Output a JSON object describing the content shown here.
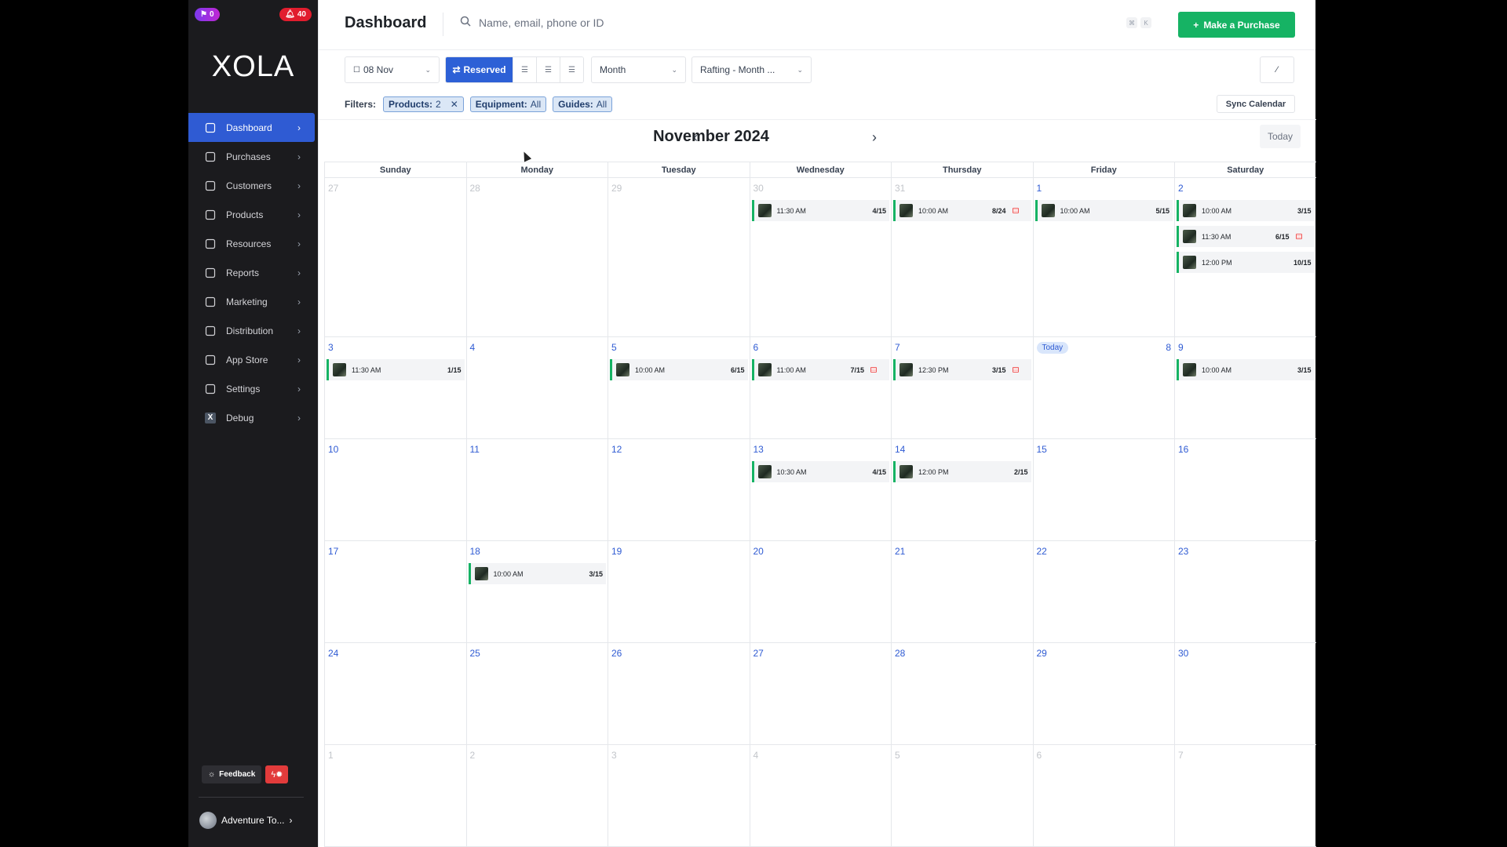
{
  "badges": {
    "notifications_left": "0",
    "alerts_right": "40"
  },
  "brand": "XOLA",
  "sidebar": {
    "items": [
      {
        "label": "Dashboard",
        "icon": "dashboard-icon",
        "active": true
      },
      {
        "label": "Purchases",
        "icon": "tag-icon"
      },
      {
        "label": "Customers",
        "icon": "users-icon"
      },
      {
        "label": "Products",
        "icon": "box-icon"
      },
      {
        "label": "Resources",
        "icon": "clipboard-icon"
      },
      {
        "label": "Reports",
        "icon": "bar-chart-icon"
      },
      {
        "label": "Marketing",
        "icon": "megaphone-icon"
      },
      {
        "label": "Distribution",
        "icon": "network-icon"
      },
      {
        "label": "App Store",
        "icon": "store-icon"
      },
      {
        "label": "Settings",
        "icon": "sliders-icon"
      },
      {
        "label": "Debug",
        "icon": "debug-x-icon"
      }
    ],
    "feedback_label": "Feedback",
    "account_label": "Adventure To..."
  },
  "header": {
    "title": "Dashboard",
    "search_placeholder": "Name, email, phone or ID",
    "kbd1": "⌘",
    "kbd2": "K",
    "purchase_label": "Make a Purchase"
  },
  "toolbar": {
    "date": "08 Nov",
    "reserved_label": "Reserved",
    "view": "Month",
    "product": "Rafting - Month ..."
  },
  "filters": {
    "label": "Filters:",
    "products_key": "Products:",
    "products_val": "2",
    "equipment_key": "Equipment:",
    "equipment_val": "All",
    "guides_key": "Guides:",
    "guides_val": "All",
    "sync_label": "Sync Calendar"
  },
  "calendar": {
    "title": "November 2024",
    "today_label": "Today",
    "days": [
      "Sunday",
      "Monday",
      "Tuesday",
      "Wednesday",
      "Thursday",
      "Friday",
      "Saturday"
    ],
    "weeks": [
      [
        {
          "d": "27",
          "muted": true,
          "ev": []
        },
        {
          "d": "28",
          "muted": true,
          "ev": []
        },
        {
          "d": "29",
          "muted": true,
          "ev": []
        },
        {
          "d": "30",
          "muted": true,
          "ev": [
            {
              "t": "11:30 AM",
              "c": "4/15"
            }
          ]
        },
        {
          "d": "31",
          "muted": true,
          "ev": [
            {
              "t": "10:00 AM",
              "c": "8/24",
              "flag": true
            }
          ]
        },
        {
          "d": "1",
          "ev": [
            {
              "t": "10:00 AM",
              "c": "5/15"
            }
          ]
        },
        {
          "d": "2",
          "ev": [
            {
              "t": "10:00 AM",
              "c": "3/15"
            },
            {
              "t": "11:30 AM",
              "c": "6/15",
              "flag": true
            },
            {
              "t": "12:00 PM",
              "c": "10/15"
            }
          ]
        }
      ],
      [
        {
          "d": "3",
          "ev": [
            {
              "t": "11:30 AM",
              "c": "1/15"
            }
          ]
        },
        {
          "d": "4",
          "ev": []
        },
        {
          "d": "5",
          "ev": [
            {
              "t": "10:00 AM",
              "c": "6/15"
            }
          ]
        },
        {
          "d": "6",
          "ev": [
            {
              "t": "11:00 AM",
              "c": "7/15",
              "flag": true
            }
          ]
        },
        {
          "d": "7",
          "ev": [
            {
              "t": "12:30 PM",
              "c": "3/15",
              "flag": true
            }
          ]
        },
        {
          "d": "8",
          "today": true,
          "ev": []
        },
        {
          "d": "9",
          "ev": [
            {
              "t": "10:00 AM",
              "c": "3/15"
            }
          ]
        }
      ],
      [
        {
          "d": "10",
          "ev": []
        },
        {
          "d": "11",
          "ev": []
        },
        {
          "d": "12",
          "ev": []
        },
        {
          "d": "13",
          "ev": [
            {
              "t": "10:30 AM",
              "c": "4/15"
            }
          ]
        },
        {
          "d": "14",
          "ev": [
            {
              "t": "12:00 PM",
              "c": "2/15"
            }
          ]
        },
        {
          "d": "15",
          "ev": []
        },
        {
          "d": "16",
          "ev": []
        }
      ],
      [
        {
          "d": "17",
          "ev": []
        },
        {
          "d": "18",
          "ev": [
            {
              "t": "10:00 AM",
              "c": "3/15"
            }
          ]
        },
        {
          "d": "19",
          "ev": []
        },
        {
          "d": "20",
          "ev": []
        },
        {
          "d": "21",
          "ev": []
        },
        {
          "d": "22",
          "ev": []
        },
        {
          "d": "23",
          "ev": []
        }
      ],
      [
        {
          "d": "24",
          "ev": []
        },
        {
          "d": "25",
          "ev": []
        },
        {
          "d": "26",
          "ev": []
        },
        {
          "d": "27",
          "ev": []
        },
        {
          "d": "28",
          "ev": []
        },
        {
          "d": "29",
          "ev": []
        },
        {
          "d": "30",
          "ev": []
        }
      ],
      [
        {
          "d": "1",
          "muted": true,
          "ev": []
        },
        {
          "d": "2",
          "muted": true,
          "ev": []
        },
        {
          "d": "3",
          "muted": true,
          "ev": []
        },
        {
          "d": "4",
          "muted": true,
          "ev": []
        },
        {
          "d": "5",
          "muted": true,
          "ev": []
        },
        {
          "d": "6",
          "muted": true,
          "ev": []
        },
        {
          "d": "7",
          "muted": true,
          "ev": []
        }
      ]
    ]
  },
  "colors": {
    "accent": "#2f5bd3",
    "green": "#16b364",
    "sidebar_bg": "#1b1b1e"
  }
}
